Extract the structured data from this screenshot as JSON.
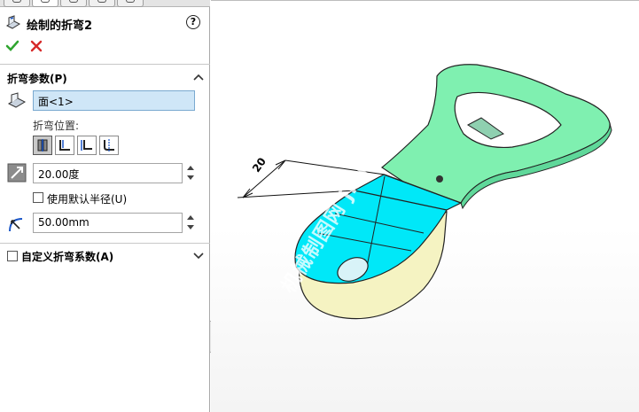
{
  "panel": {
    "title": "绘制的折弯2",
    "help_glyph": "?",
    "ok_icon": "check-icon",
    "cancel_icon": "close-icon"
  },
  "bend_params": {
    "header": "折弯参数(P)",
    "face_field_value": "面<1>",
    "bend_position_label": "折弯位置:",
    "positions": [
      {
        "name": "bend-centerline",
        "selected": true
      },
      {
        "name": "material-inside",
        "selected": false
      },
      {
        "name": "material-outside",
        "selected": false
      },
      {
        "name": "bend-outside",
        "selected": false
      }
    ],
    "angle_value": "20.00度",
    "use_default_radius_label": "使用默认半径(U)",
    "use_default_radius_checked": false,
    "radius_value": "50.00mm"
  },
  "custom_factor": {
    "header": "自定义折弯系数(A)",
    "checked": false
  },
  "viewport": {
    "dimension_text": "20",
    "watermark": "机械制图网 jixie5.com",
    "colors": {
      "green_face": "#7ff0b0",
      "blue_face": "#00e8f8",
      "yellow_face": "#f5f3c2"
    }
  }
}
